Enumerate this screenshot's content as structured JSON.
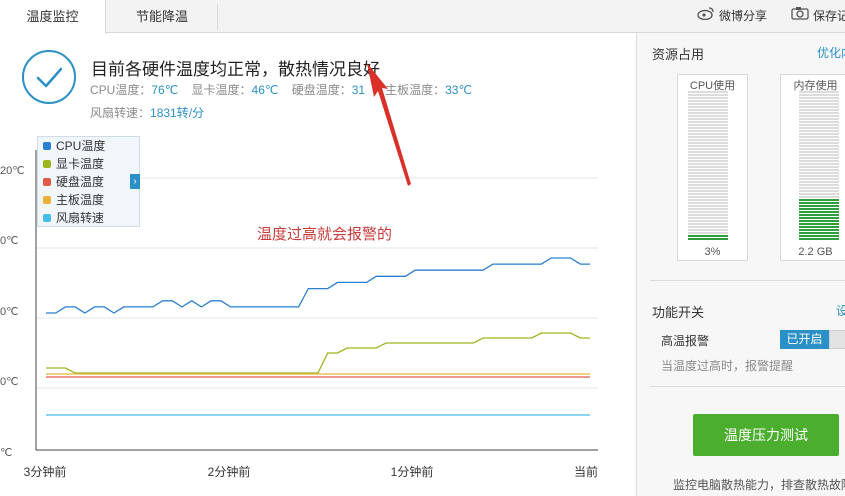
{
  "tabs": [
    {
      "label": "温度监控",
      "active": true
    },
    {
      "label": "节能降温",
      "active": false
    }
  ],
  "toolbar": {
    "weibo_share_label": "微博分享",
    "save_label": "保存记"
  },
  "status": {
    "title": "目前各硬件温度均正常，散热情况良好",
    "cpu_label": "CPU温度：",
    "cpu_value": "76℃",
    "gpu_label": "显卡温度：",
    "gpu_value": "46℃",
    "disk_label": "硬盘温度：",
    "disk_value": "31",
    "board_label": "主板温度：",
    "board_value": "33℃",
    "fan_label": "风扇转速：",
    "fan_value": "1831转/分"
  },
  "annotation": "温度过高就会报警的",
  "chart_data": {
    "type": "line",
    "y_tick_labels": [
      "20℃",
      "0℃",
      "0℃",
      "0℃",
      "℃"
    ],
    "x_tick_labels": [
      "3分钟前",
      "2分钟前",
      "1分钟前",
      "当前"
    ],
    "legend": [
      "CPU温度",
      "显卡温度",
      "硬盘温度",
      "主板温度",
      "风扇转速"
    ],
    "colors": {
      "cpu": "#2a7fd0",
      "gpu": "#9ab81e",
      "disk": "#e05a4a",
      "board": "#e8b13a",
      "fan": "#45bde6"
    },
    "series": [
      {
        "name": "CPU温度",
        "color": "#2a7fd0",
        "values": [
          76,
          76,
          77,
          77,
          76,
          77,
          77,
          76,
          77,
          77,
          77,
          77,
          78,
          78,
          77,
          78,
          77,
          78,
          78,
          77,
          77,
          77,
          77,
          77,
          77,
          77,
          77,
          80,
          80,
          80,
          81,
          81,
          81,
          81,
          82,
          82,
          82,
          82,
          83,
          83,
          83,
          83,
          83,
          83,
          83,
          83,
          84,
          84,
          84,
          84,
          84,
          84,
          85,
          85,
          85,
          84,
          84
        ]
      },
      {
        "name": "显卡温度",
        "color": "#9ab81e",
        "values": [
          46,
          46,
          46,
          45,
          45,
          45,
          45,
          45,
          45,
          45,
          45,
          45,
          45,
          45,
          45,
          45,
          45,
          45,
          45,
          45,
          45,
          45,
          45,
          45,
          45,
          45,
          45,
          45,
          45,
          49,
          49,
          50,
          50,
          50,
          50,
          51,
          51,
          51,
          51,
          51,
          51,
          51,
          51,
          51,
          51,
          52,
          52,
          52,
          52,
          52,
          52,
          53,
          53,
          53,
          53,
          52,
          52
        ]
      },
      {
        "name": "硬盘温度",
        "color": "#e05a4a",
        "values": [
          31,
          31,
          31,
          31,
          31,
          31,
          31,
          31,
          31,
          31,
          31,
          31,
          31,
          31,
          31,
          31,
          31,
          31,
          31,
          31,
          31,
          31,
          31,
          31,
          31,
          31,
          31,
          31,
          31,
          31,
          31,
          31,
          31,
          31,
          31,
          31,
          31,
          31,
          31,
          31,
          31,
          31,
          31,
          31,
          31,
          31,
          31,
          31,
          31,
          31,
          31,
          31,
          31,
          31,
          31,
          31,
          31
        ]
      },
      {
        "name": "主板温度",
        "color": "#e8b13a",
        "values": [
          33,
          33,
          33,
          33,
          33,
          33,
          33,
          33,
          33,
          33,
          33,
          33,
          33,
          33,
          33,
          33,
          33,
          33,
          33,
          33,
          33,
          33,
          33,
          33,
          33,
          33,
          33,
          33,
          33,
          33,
          33,
          33,
          33,
          33,
          33,
          33,
          33,
          33,
          33,
          33,
          33,
          33,
          33,
          33,
          33,
          33,
          33,
          33,
          33,
          33,
          33,
          33,
          33,
          33,
          33,
          33,
          33
        ]
      },
      {
        "name": "风扇转速",
        "color": "#45bde6",
        "values": [
          1831,
          1831,
          1831,
          1831,
          1831,
          1831,
          1831,
          1831,
          1831,
          1831,
          1831,
          1831,
          1831,
          1831,
          1831,
          1831,
          1831,
          1831,
          1831,
          1831,
          1831,
          1831,
          1831,
          1831,
          1831,
          1831,
          1831,
          1831,
          1831,
          1831,
          1831,
          1831,
          1831,
          1831,
          1831,
          1831,
          1831,
          1831,
          1831,
          1831,
          1831,
          1831,
          1831,
          1831,
          1831,
          1831,
          1831,
          1831,
          1831,
          1831,
          1831,
          1831,
          1831,
          1831,
          1831,
          1831,
          1831
        ]
      }
    ]
  },
  "resources": {
    "title": "资源占用",
    "optimize_link": "优化内",
    "cpu_label": "CPU使用",
    "cpu_value": "3%",
    "cpu_fraction": 0.03,
    "mem_label": "内存使用",
    "mem_value": "2.2 GB",
    "mem_fraction": 0.27
  },
  "features": {
    "title": "功能开关",
    "settings_link": "设",
    "alarm_label": "高温报警",
    "alarm_state": "已开启",
    "alarm_desc": "当温度过高时，报警提醒",
    "test_button": "温度压力测试",
    "bottom_desc": "监控电脑散热能力，排查散热故障"
  }
}
